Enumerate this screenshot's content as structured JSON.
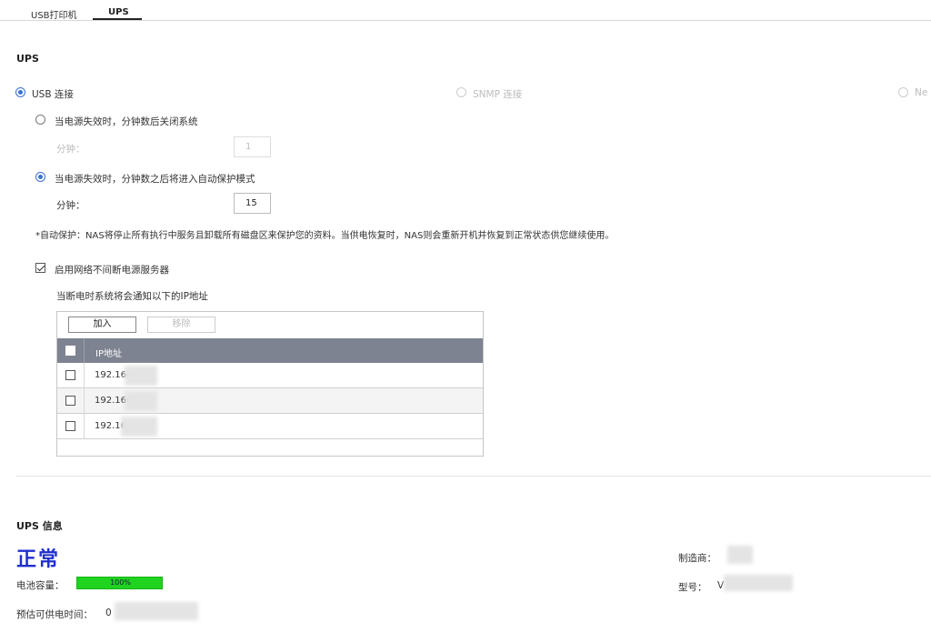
{
  "tabs": [
    {
      "label": "USB打印机",
      "active": false
    },
    {
      "label": "UPS",
      "active": true
    }
  ],
  "ups": {
    "title": "UPS",
    "modes": [
      {
        "label": "USB 连接",
        "selected": true,
        "enabled": true
      },
      {
        "label": "SNMP 连接",
        "selected": false,
        "enabled": false
      },
      {
        "label": "Ne",
        "selected": false,
        "enabled": false
      }
    ],
    "option_shutdown": {
      "label": "当电源失效时，分钟数后关闭系统",
      "selected": false,
      "minutes_label": "分钟：",
      "minutes": "1"
    },
    "option_protect": {
      "label": "当电源失效时，分钟数之后将进入自动保护模式",
      "selected": true,
      "minutes_label": "分钟：",
      "minutes": "15"
    },
    "note": "*自动保护：NAS将停止所有执行中服务且卸载所有磁盘区来保护您的资料。当供电恢复时，NAS则会重新开机并恢复到正常状态供您继续使用。",
    "network_server": {
      "label": "启用网络不间断电源服务器",
      "checked": true
    },
    "notify_label": "当断电时系统将会通知以下的IP地址",
    "grid": {
      "add_label": "加入",
      "remove_label": "移除",
      "column_header": "IP地址",
      "rows": [
        {
          "ip": "192.16("
        },
        {
          "ip": "192.16("
        },
        {
          "ip": "192.16"
        }
      ]
    }
  },
  "info": {
    "title": "UPS 信息",
    "status": "正常",
    "status_color": "#1f2fcf",
    "battery_label": "电池容量：",
    "battery_percent": 100,
    "battery_text": "100%",
    "runtime_label": "预估可供电时间：",
    "runtime_value": "0",
    "manufacturer_label": "制造商：",
    "model_label": "型号：",
    "model_value": "V"
  }
}
